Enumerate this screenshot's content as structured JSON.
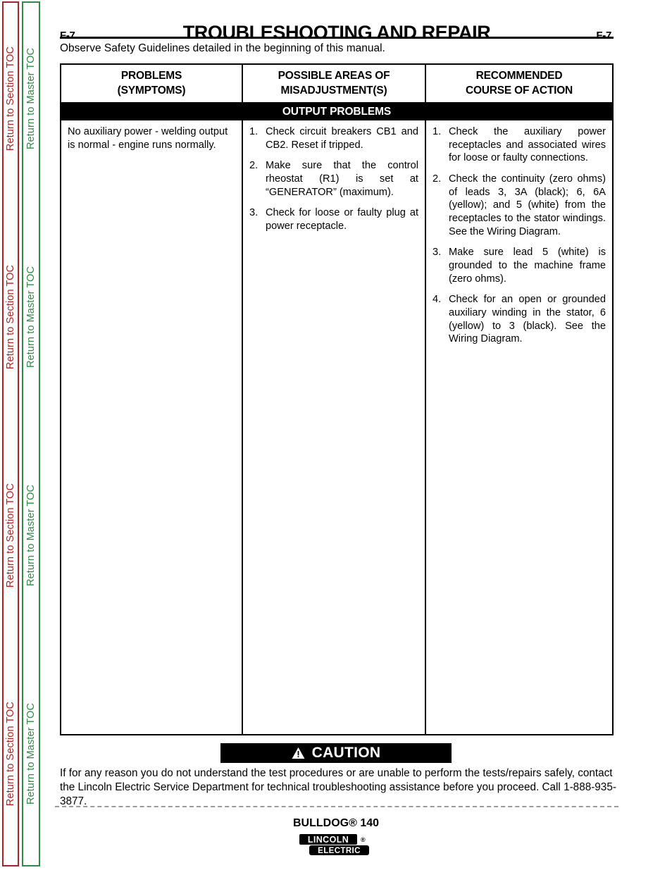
{
  "sidebar": {
    "section_toc_label": "Return to Section TOC",
    "master_toc_label": "Return to Master TOC",
    "section_color": "#b22222",
    "master_color": "#2e8b45",
    "repeat_count": 4
  },
  "header": {
    "folio_left": "F-7",
    "folio_right": "F-7",
    "title": "TROUBLESHOOTING AND REPAIR",
    "safety_note": "Observe Safety Guidelines detailed in the beginning of this manual."
  },
  "table": {
    "columns": [
      {
        "line1": "PROBLEMS",
        "line2": "(SYMPTOMS)"
      },
      {
        "line1": "POSSIBLE AREAS OF",
        "line2": "MISADJUSTMENT(S)"
      },
      {
        "line1": "RECOMMENDED",
        "line2": "COURSE OF ACTION"
      }
    ],
    "section_band": "OUTPUT PROBLEMS",
    "row": {
      "symptom": "No auxiliary power - welding output is normal - engine runs normally.",
      "misadjustments": [
        {
          "num": "1.",
          "text": "Check circuit breakers CB1 and CB2.  Reset if tripped."
        },
        {
          "num": "2.",
          "text": "Make sure that the control rheostat (R1) is set at “GENERATOR” (maximum)."
        },
        {
          "num": "3.",
          "text": "Check for loose or faulty plug at power receptacle."
        }
      ],
      "actions": [
        {
          "num": "1.",
          "text": "Check the auxiliary power receptacles and associated wires for loose or faulty connections."
        },
        {
          "num": "2.",
          "text": "Check the continuity (zero ohms) of leads 3, 3A (black); 6, 6A (yellow); and 5 (white) from the receptacles to the stator windings.  See the Wiring Diagram."
        },
        {
          "num": "3.",
          "text": "Make sure lead 5 (white) is grounded to the machine frame (zero ohms)."
        },
        {
          "num": "4.",
          "text": "Check for an open or grounded auxiliary winding in the stator, 6 (yellow) to 3 (black).  See the Wiring Diagram."
        }
      ]
    }
  },
  "caution": {
    "label": "CAUTION",
    "body": "If for any reason you do not understand the test procedures or are unable to perform the tests/repairs safely, contact the Lincoln Electric Service Department for technical troubleshooting assistance before you proceed. Call 1-888-935-3877."
  },
  "footer": {
    "product": "BULLDOG® 140",
    "logo_top": "LINCOLN",
    "logo_reg": "®",
    "logo_bottom": "ELECTRIC"
  }
}
